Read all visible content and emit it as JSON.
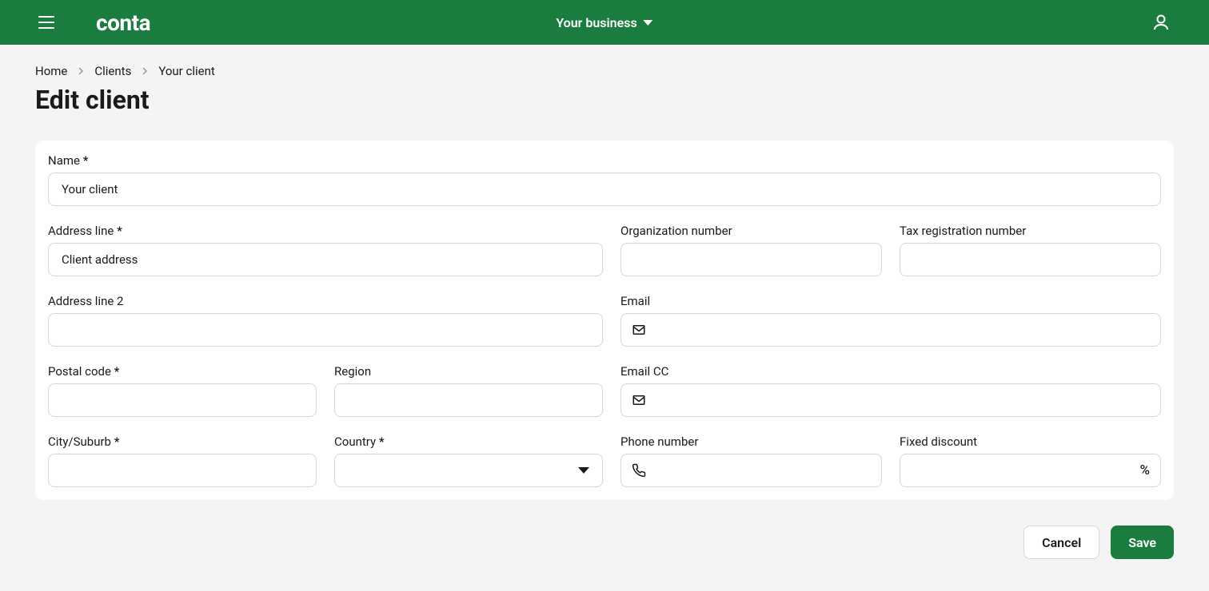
{
  "header": {
    "logo": "conta",
    "business_label": "Your business"
  },
  "breadcrumb": {
    "home": "Home",
    "clients": "Clients",
    "current": "Your client"
  },
  "page_title": "Edit client",
  "form": {
    "name": {
      "label": "Name",
      "value": "Your client"
    },
    "address_line": {
      "label": "Address line",
      "value": "Client address"
    },
    "address_line_2": {
      "label": "Address line 2",
      "value": ""
    },
    "postal_code": {
      "label": "Postal code",
      "value": ""
    },
    "region": {
      "label": "Region",
      "value": ""
    },
    "city_suburb": {
      "label": "City/Suburb",
      "value": ""
    },
    "country": {
      "label": "Country",
      "value": ""
    },
    "org_number": {
      "label": "Organization number",
      "value": ""
    },
    "tax_reg_number": {
      "label": "Tax registration number",
      "value": ""
    },
    "email": {
      "label": "Email",
      "value": ""
    },
    "email_cc": {
      "label": "Email CC",
      "value": ""
    },
    "phone": {
      "label": "Phone number",
      "value": ""
    },
    "fixed_discount": {
      "label": "Fixed discount",
      "value": "",
      "suffix": "%"
    }
  },
  "actions": {
    "cancel": "Cancel",
    "save": "Save"
  }
}
